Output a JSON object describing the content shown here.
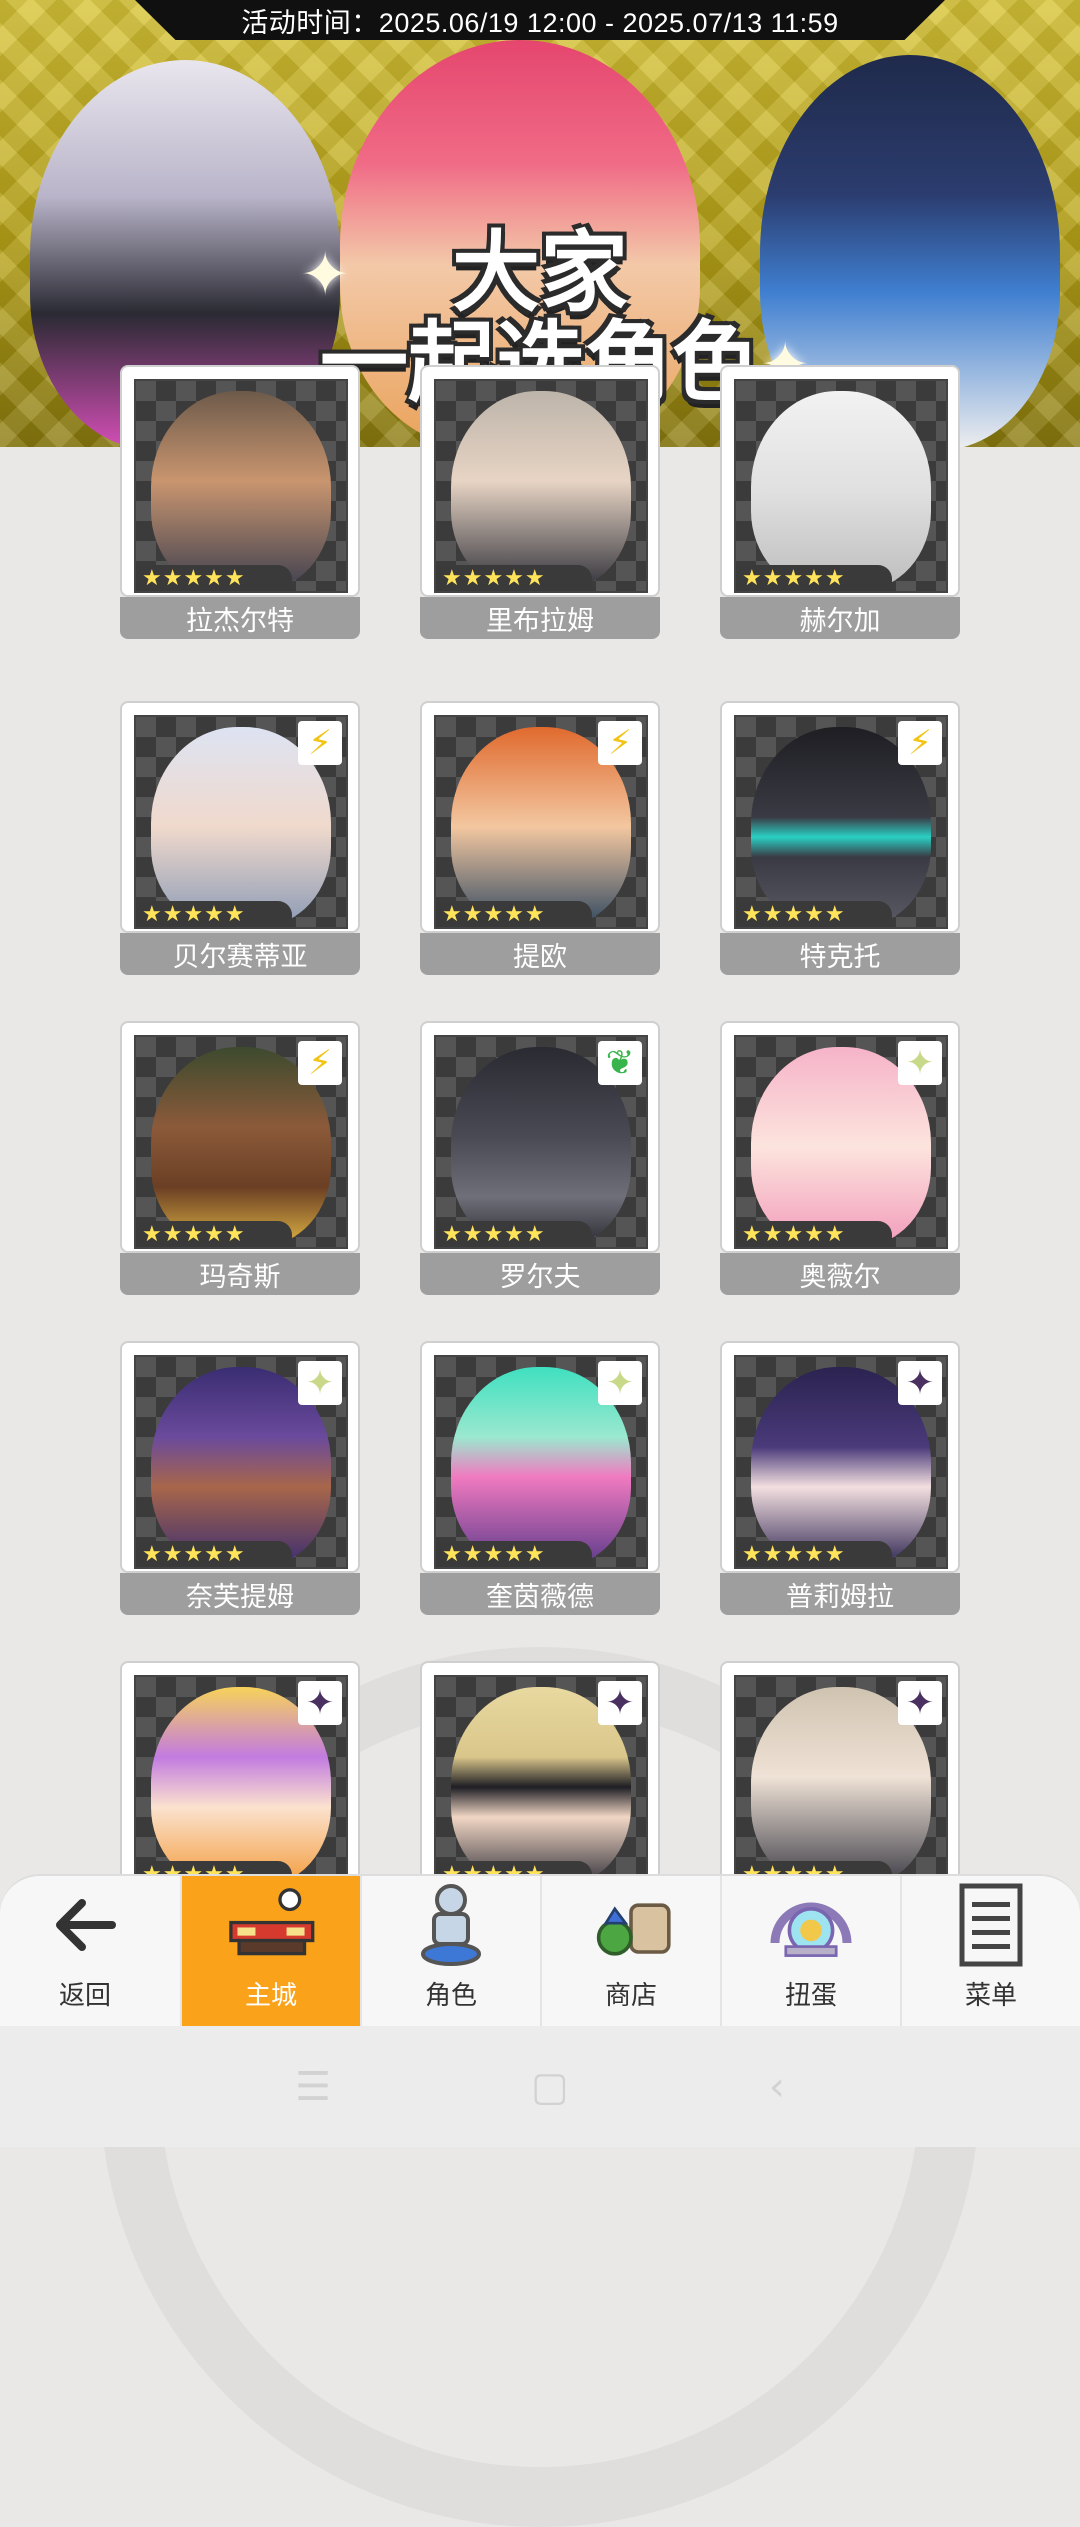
{
  "banner": {
    "time_text": "活动时间：2025.06/19 12:00 - 2025.07/13 11:59",
    "title_line1": "大家",
    "title_line2": "一起选角色"
  },
  "colors": {
    "active_nav": "#fba21b",
    "name_plate": "#9e9e9e",
    "banner_yellow": "#c9b62a"
  },
  "characters": [
    {
      "name": "拉杰尔特",
      "element": "none",
      "stars": "★★★★★"
    },
    {
      "name": "里布拉姆",
      "element": "none",
      "stars": "★★★★★"
    },
    {
      "name": "赫尔加",
      "element": "none",
      "stars": "★★★★★"
    },
    {
      "name": "贝尔赛蒂亚",
      "element": "lightning-icon",
      "stars": "★★★★★"
    },
    {
      "name": "提欧",
      "element": "lightning-icon",
      "stars": "★★★★★"
    },
    {
      "name": "特克托",
      "element": "lightning-icon",
      "stars": "★★★★★"
    },
    {
      "name": "玛奇斯",
      "element": "lightning-icon",
      "stars": "★★★★★"
    },
    {
      "name": "罗尔夫",
      "element": "leaf-icon",
      "stars": "★★★★★"
    },
    {
      "name": "奥薇尔",
      "element": "light-sparkle-icon",
      "stars": "★★★★★"
    },
    {
      "name": "奈芙提姆",
      "element": "light-sparkle-icon",
      "stars": "★★★★★"
    },
    {
      "name": "奎茵薇德",
      "element": "light-sparkle-icon",
      "stars": "★★★★★"
    },
    {
      "name": "普莉姆拉",
      "element": "dark-sparkle-icon",
      "stars": "★★★★★"
    },
    {
      "name": "",
      "element": "dark-sparkle-icon",
      "stars": "★★★★★"
    },
    {
      "name": "",
      "element": "dark-sparkle-icon",
      "stars": "★★★★★"
    },
    {
      "name": "",
      "element": "dark-sparkle-icon",
      "stars": "★★★★★"
    }
  ],
  "nav": {
    "back": "返回",
    "main_city": "主城",
    "character": "角色",
    "shop": "商店",
    "gacha": "扭蛋",
    "menu": "菜单"
  }
}
